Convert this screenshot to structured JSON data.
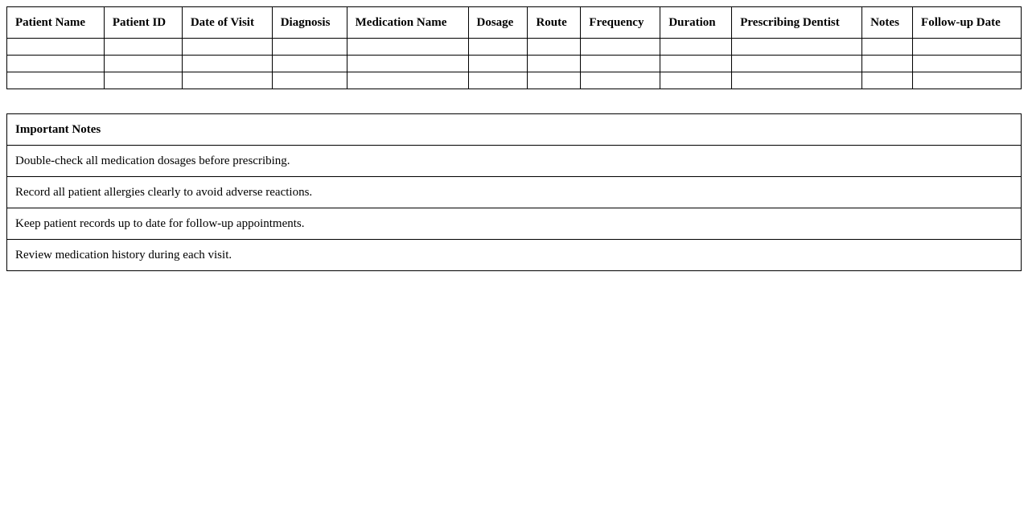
{
  "records_table": {
    "headers": [
      "Patient Name",
      "Patient ID",
      "Date of Visit",
      "Diagnosis",
      "Medication Name",
      "Dosage",
      "Route",
      "Frequency",
      "Duration",
      "Prescribing Dentist",
      "Notes",
      "Follow-up Date"
    ],
    "rows": [
      [
        "",
        "",
        "",
        "",
        "",
        "",
        "",
        "",
        "",
        "",
        "",
        ""
      ],
      [
        "",
        "",
        "",
        "",
        "",
        "",
        "",
        "",
        "",
        "",
        "",
        ""
      ],
      [
        "",
        "",
        "",
        "",
        "",
        "",
        "",
        "",
        "",
        "",
        "",
        ""
      ]
    ]
  },
  "notes_table": {
    "heading": "Important Notes",
    "items": [
      "Double-check all medication dosages before prescribing.",
      "Record all patient allergies clearly to avoid adverse reactions.",
      "Keep patient records up to date for follow-up appointments.",
      "Review medication history during each visit."
    ]
  }
}
